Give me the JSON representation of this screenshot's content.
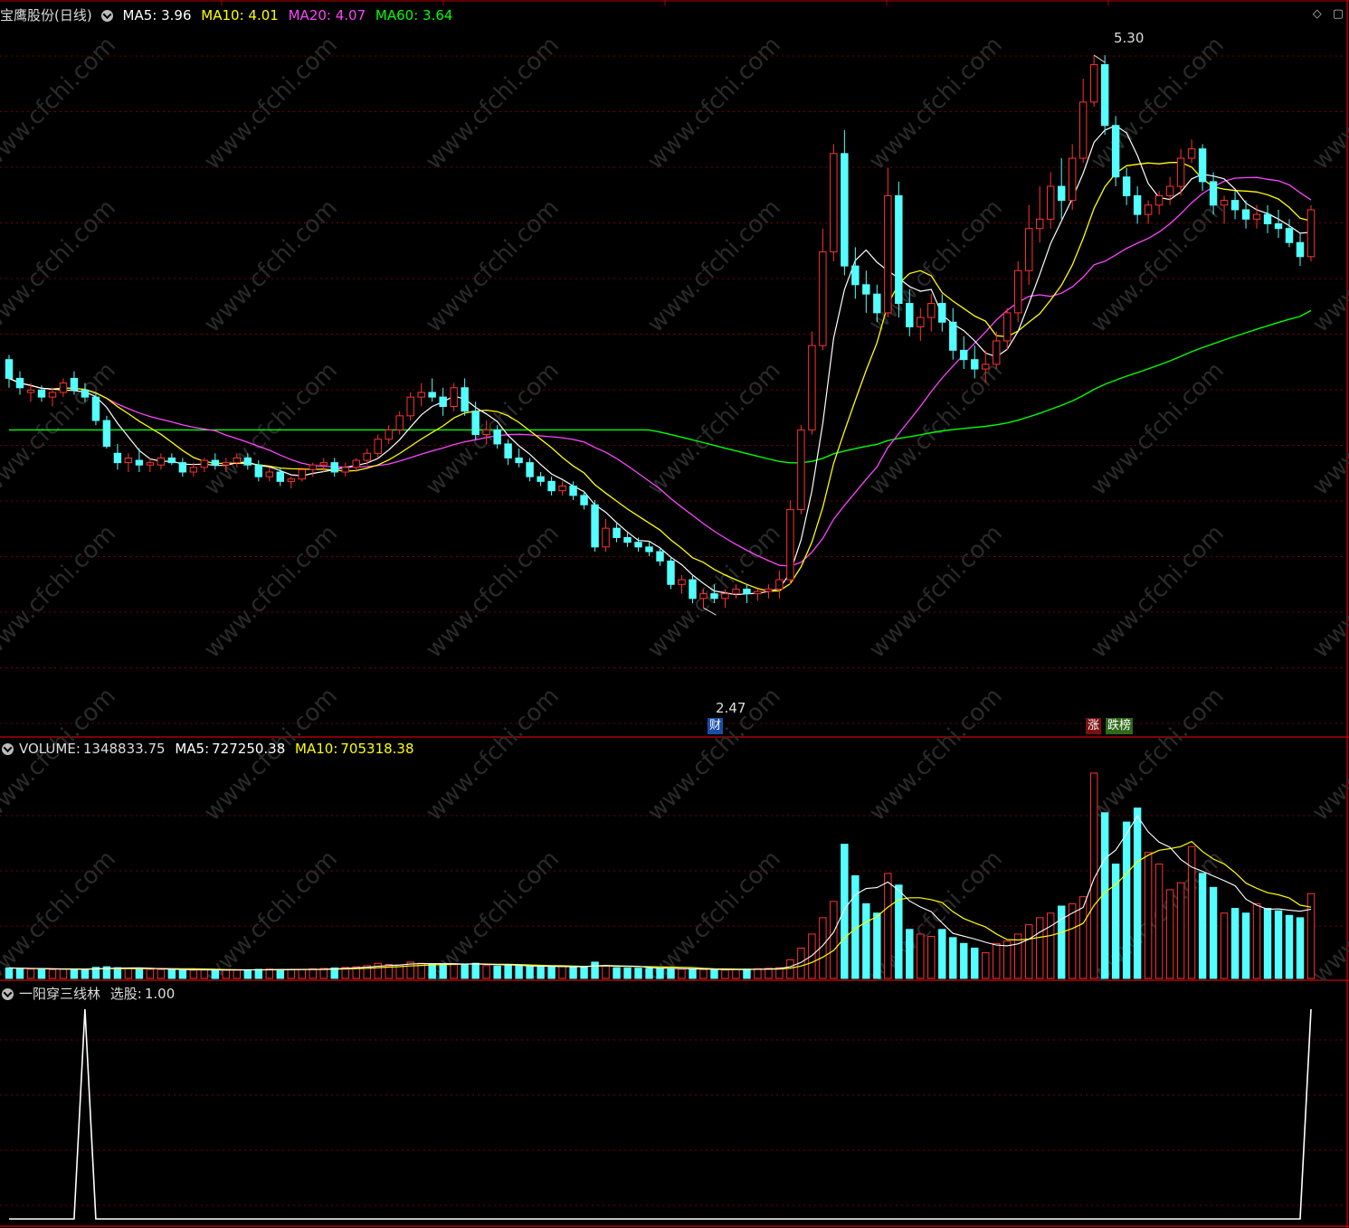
{
  "price_panel": {
    "stock_name": "宝鹰股份",
    "period": "(日线)",
    "ma5": {
      "label": "MA5:",
      "value": "3.96",
      "color": "#ffffff"
    },
    "ma10": {
      "label": "MA10:",
      "value": "4.01",
      "color": "#ffff00"
    },
    "ma20": {
      "label": "MA20:",
      "value": "4.07",
      "color": "#ff44ff"
    },
    "ma60": {
      "label": "MA60:",
      "value": "3.64",
      "color": "#00ff00"
    },
    "high_marker": "5.30",
    "low_marker": "2.47",
    "event_tag_finance": "财",
    "event_tag_up": "涨",
    "event_tag_board": "跌榜"
  },
  "volume_panel": {
    "label": "VOLUME:",
    "value": "1348833.75",
    "ma5_label": "MA5:",
    "ma5_value": "727250.38",
    "ma10_label": "MA10:",
    "ma10_value": "705318.38"
  },
  "indicator_panel": {
    "name": "一阳穿三线林",
    "signal_label": "选股:",
    "signal_value": "1.00"
  },
  "watermark": "www.cfchi.com",
  "colors": {
    "up": "#ff3232",
    "down": "#54ffff",
    "grid": "#7a0000",
    "border": "#b00000"
  },
  "chart_data": [
    {
      "type": "candlestick",
      "title": "宝鹰股份(日线)",
      "ohlc": [
        [
          4.0,
          4.02,
          3.88,
          3.92
        ],
        [
          3.92,
          3.95,
          3.85,
          3.88
        ],
        [
          3.86,
          3.9,
          3.82,
          3.87
        ],
        [
          3.87,
          3.89,
          3.82,
          3.84
        ],
        [
          3.84,
          3.88,
          3.8,
          3.86
        ],
        [
          3.86,
          3.92,
          3.84,
          3.9
        ],
        [
          3.92,
          3.95,
          3.85,
          3.87
        ],
        [
          3.87,
          3.9,
          3.82,
          3.84
        ],
        [
          3.84,
          3.86,
          3.72,
          3.74
        ],
        [
          3.74,
          3.76,
          3.62,
          3.63
        ],
        [
          3.6,
          3.64,
          3.53,
          3.56
        ],
        [
          3.56,
          3.6,
          3.52,
          3.58
        ],
        [
          3.57,
          3.62,
          3.52,
          3.55
        ],
        [
          3.55,
          3.58,
          3.52,
          3.56
        ],
        [
          3.55,
          3.6,
          3.53,
          3.58
        ],
        [
          3.58,
          3.6,
          3.55,
          3.56
        ],
        [
          3.56,
          3.58,
          3.5,
          3.52
        ],
        [
          3.52,
          3.56,
          3.5,
          3.54
        ],
        [
          3.54,
          3.58,
          3.52,
          3.57
        ],
        [
          3.57,
          3.6,
          3.53,
          3.55
        ],
        [
          3.55,
          3.58,
          3.52,
          3.56
        ],
        [
          3.56,
          3.6,
          3.54,
          3.58
        ],
        [
          3.58,
          3.6,
          3.53,
          3.55
        ],
        [
          3.55,
          3.57,
          3.48,
          3.5
        ],
        [
          3.5,
          3.54,
          3.48,
          3.52
        ],
        [
          3.52,
          3.54,
          3.46,
          3.48
        ],
        [
          3.48,
          3.5,
          3.45,
          3.49
        ],
        [
          3.49,
          3.54,
          3.48,
          3.53
        ],
        [
          3.53,
          3.56,
          3.5,
          3.55
        ],
        [
          3.55,
          3.58,
          3.52,
          3.56
        ],
        [
          3.56,
          3.58,
          3.5,
          3.52
        ],
        [
          3.52,
          3.56,
          3.5,
          3.54
        ],
        [
          3.54,
          3.58,
          3.52,
          3.57
        ],
        [
          3.57,
          3.62,
          3.55,
          3.6
        ],
        [
          3.6,
          3.68,
          3.58,
          3.66
        ],
        [
          3.66,
          3.72,
          3.64,
          3.7
        ],
        [
          3.7,
          3.78,
          3.68,
          3.76
        ],
        [
          3.76,
          3.86,
          3.74,
          3.84
        ],
        [
          3.84,
          3.9,
          3.8,
          3.86
        ],
        [
          3.86,
          3.92,
          3.82,
          3.84
        ],
        [
          3.84,
          3.88,
          3.76,
          3.8
        ],
        [
          3.8,
          3.9,
          3.78,
          3.88
        ],
        [
          3.88,
          3.92,
          3.76,
          3.78
        ],
        [
          3.78,
          3.82,
          3.66,
          3.68
        ],
        [
          3.68,
          3.74,
          3.64,
          3.7
        ],
        [
          3.7,
          3.72,
          3.62,
          3.64
        ],
        [
          3.64,
          3.66,
          3.55,
          3.58
        ],
        [
          3.58,
          3.62,
          3.54,
          3.56
        ],
        [
          3.56,
          3.58,
          3.48,
          3.5
        ],
        [
          3.5,
          3.52,
          3.46,
          3.48
        ],
        [
          3.48,
          3.5,
          3.42,
          3.44
        ],
        [
          3.44,
          3.48,
          3.42,
          3.46
        ],
        [
          3.46,
          3.48,
          3.4,
          3.42
        ],
        [
          3.42,
          3.44,
          3.36,
          3.38
        ],
        [
          3.38,
          3.4,
          3.18,
          3.2
        ],
        [
          3.2,
          3.32,
          3.18,
          3.28
        ],
        [
          3.28,
          3.3,
          3.22,
          3.24
        ],
        [
          3.24,
          3.26,
          3.2,
          3.22
        ],
        [
          3.22,
          3.24,
          3.18,
          3.2
        ],
        [
          3.2,
          3.22,
          3.16,
          3.18
        ],
        [
          3.18,
          3.2,
          3.12,
          3.14
        ],
        [
          3.14,
          3.16,
          3.02,
          3.04
        ],
        [
          3.04,
          3.08,
          3.0,
          3.06
        ],
        [
          3.06,
          3.08,
          2.96,
          2.98
        ],
        [
          2.98,
          3.02,
          2.94,
          3.0
        ],
        [
          3.0,
          3.04,
          2.96,
          2.98
        ],
        [
          2.98,
          3.02,
          2.94,
          3.0
        ],
        [
          3.0,
          3.04,
          2.98,
          3.02
        ],
        [
          3.02,
          3.04,
          2.96,
          3.0
        ],
        [
          3.0,
          3.02,
          2.97,
          3.01
        ],
        [
          3.01,
          3.04,
          2.98,
          3.02
        ],
        [
          3.02,
          3.1,
          2.98,
          3.06
        ],
        [
          3.06,
          3.4,
          3.04,
          3.36
        ],
        [
          3.36,
          3.72,
          3.34,
          3.7
        ],
        [
          3.7,
          4.12,
          3.68,
          4.06
        ],
        [
          4.06,
          4.56,
          4.04,
          4.46
        ],
        [
          4.46,
          4.92,
          4.42,
          4.88
        ],
        [
          4.88,
          4.98,
          4.36,
          4.4
        ],
        [
          4.4,
          4.48,
          4.26,
          4.32
        ],
        [
          4.32,
          4.38,
          4.2,
          4.28
        ],
        [
          4.28,
          4.32,
          4.16,
          4.2
        ],
        [
          4.2,
          4.82,
          4.18,
          4.7
        ],
        [
          4.7,
          4.76,
          4.18,
          4.24
        ],
        [
          4.24,
          4.3,
          4.1,
          4.14
        ],
        [
          4.14,
          4.22,
          4.08,
          4.18
        ],
        [
          4.18,
          4.28,
          4.12,
          4.24
        ],
        [
          4.24,
          4.28,
          4.12,
          4.16
        ],
        [
          4.16,
          4.22,
          4.0,
          4.04
        ],
        [
          4.04,
          4.1,
          3.96,
          4.0
        ],
        [
          4.0,
          4.06,
          3.92,
          3.96
        ],
        [
          3.96,
          4.04,
          3.9,
          3.98
        ],
        [
          3.98,
          4.12,
          3.96,
          4.08
        ],
        [
          4.08,
          4.22,
          4.04,
          4.2
        ],
        [
          4.2,
          4.42,
          4.16,
          4.38
        ],
        [
          4.38,
          4.66,
          4.32,
          4.56
        ],
        [
          4.56,
          4.74,
          4.5,
          4.6
        ],
        [
          4.6,
          4.8,
          4.56,
          4.74
        ],
        [
          4.74,
          4.86,
          4.6,
          4.68
        ],
        [
          4.68,
          4.92,
          4.64,
          4.86
        ],
        [
          4.86,
          5.2,
          4.84,
          5.1
        ],
        [
          5.1,
          5.3,
          5.08,
          5.26
        ],
        [
          5.26,
          5.3,
          4.96,
          5.0
        ],
        [
          5.0,
          5.04,
          4.74,
          4.78
        ],
        [
          4.78,
          4.82,
          4.66,
          4.7
        ],
        [
          4.7,
          4.74,
          4.58,
          4.62
        ],
        [
          4.62,
          4.68,
          4.58,
          4.66
        ],
        [
          4.66,
          4.72,
          4.62,
          4.7
        ],
        [
          4.7,
          4.78,
          4.66,
          4.74
        ],
        [
          4.74,
          4.9,
          4.7,
          4.86
        ],
        [
          4.86,
          4.94,
          4.84,
          4.9
        ],
        [
          4.9,
          4.92,
          4.72,
          4.76
        ],
        [
          4.76,
          4.8,
          4.62,
          4.66
        ],
        [
          4.66,
          4.7,
          4.58,
          4.68
        ],
        [
          4.68,
          4.72,
          4.6,
          4.64
        ],
        [
          4.64,
          4.68,
          4.56,
          4.6
        ],
        [
          4.6,
          4.66,
          4.56,
          4.62
        ],
        [
          4.62,
          4.66,
          4.54,
          4.58
        ],
        [
          4.58,
          4.64,
          4.52,
          4.56
        ],
        [
          4.56,
          4.6,
          4.48,
          4.5
        ],
        [
          4.5,
          4.54,
          4.4,
          4.44
        ],
        [
          4.44,
          4.66,
          4.42,
          4.64
        ]
      ],
      "ylim": [
        2.4,
        5.42
      ]
    },
    {
      "type": "bar",
      "title": "VOLUME",
      "values": [
        90,
        85,
        80,
        82,
        75,
        78,
        80,
        76,
        95,
        100,
        92,
        88,
        80,
        78,
        76,
        74,
        72,
        70,
        74,
        76,
        70,
        72,
        74,
        78,
        80,
        76,
        74,
        78,
        82,
        86,
        90,
        95,
        100,
        110,
        130,
        120,
        115,
        140,
        130,
        125,
        120,
        118,
        124,
        130,
        110,
        105,
        112,
        108,
        100,
        98,
        96,
        104,
        102,
        98,
        140,
        110,
        92,
        90,
        88,
        86,
        84,
        82,
        80,
        78,
        76,
        74,
        72,
        78,
        80,
        84,
        88,
        92,
        160,
        260,
        380,
        520,
        660,
        1150,
        880,
        640,
        560,
        900,
        800,
        420,
        380,
        360,
        420,
        350,
        300,
        260,
        220,
        300,
        320,
        380,
        460,
        520,
        560,
        620,
        640,
        700,
        1760,
        1420,
        980,
        1340,
        1460,
        1080,
        980,
        760,
        820,
        1130,
        900,
        780,
        560,
        600,
        560,
        640,
        600,
        580,
        540,
        520,
        727
      ],
      "ylim": [
        0,
        1860
      ]
    },
    {
      "type": "line",
      "title": "一阳穿三线林",
      "series": [
        {
          "name": "选股",
          "values": "1 at the 8th bar and at the last bar, 0 elsewhere"
        }
      ],
      "ylim": [
        0,
        1
      ]
    }
  ]
}
